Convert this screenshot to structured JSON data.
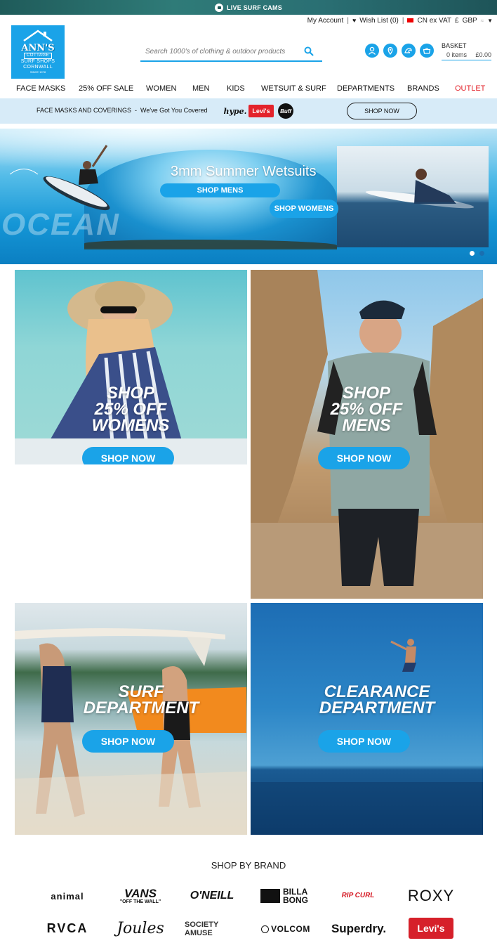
{
  "topbar": {
    "live_cams": "LIVE SURF CAMS"
  },
  "utility": {
    "my_account": "My Account",
    "wish_list": "Wish List (0)",
    "vat": "CN ex VAT",
    "currency_symbol": "£",
    "currency": "GBP"
  },
  "logo": {
    "line1": "ANN'S",
    "line2": "COTTAGE",
    "line3": "SURF SHOPS",
    "line4": "CORNWALL",
    "line5": "SINCE 1978"
  },
  "search": {
    "placeholder": "Search 1000's of clothing & outdoor products"
  },
  "basket": {
    "label": "BASKET",
    "items": "0 items",
    "total": "£0.00"
  },
  "nav": {
    "items": [
      "FACE MASKS",
      "25% OFF SALE",
      "WOMEN",
      "MEN",
      "KIDS",
      "WETSUIT & SURF",
      "DEPARTMENTS",
      "BRANDS",
      "OUTLET"
    ]
  },
  "promo": {
    "text": "FACE MASKS AND COVERINGS  -  We've Got You Covered",
    "brands": [
      "hype.",
      "Levi's",
      "Buff"
    ],
    "button": "SHOP NOW"
  },
  "hero": {
    "title": "3mm Summer Wetsuits",
    "button_mens": "SHOP MENS",
    "button_womens": "SHOP WOMENS",
    "bg_text": "OCEAN"
  },
  "tiles": [
    {
      "title_lines": [
        "SHOP",
        "25% OFF",
        "WOMENS"
      ],
      "button": "SHOP NOW"
    },
    {
      "title_lines": [
        "SHOP",
        "25% OFF",
        "MENS"
      ],
      "button": "SHOP NOW"
    },
    {
      "title_lines": [
        "SURF",
        "DEPARTMENT"
      ],
      "button": "SHOP NOW"
    },
    {
      "title_lines": [
        "CLEARANCE",
        "DEPARTMENT"
      ],
      "button": "SHOP NOW"
    }
  ],
  "brands": {
    "title": "SHOP BY BRAND",
    "row1": [
      "animal",
      "VANS",
      "O'NEILL",
      "BILLA BONG",
      "RIP CURL",
      "ROXY"
    ],
    "row2": [
      "RVCA",
      "Joules",
      "SOCIETY AMUSE",
      "VOLCOM",
      "Superdry.",
      "Levi's"
    ],
    "vans_sub": "\"OFF THE WALL\""
  },
  "colors": {
    "accent": "#1aa3e8",
    "outlet": "#e3232b",
    "promo_bg": "#d7ebf8"
  }
}
